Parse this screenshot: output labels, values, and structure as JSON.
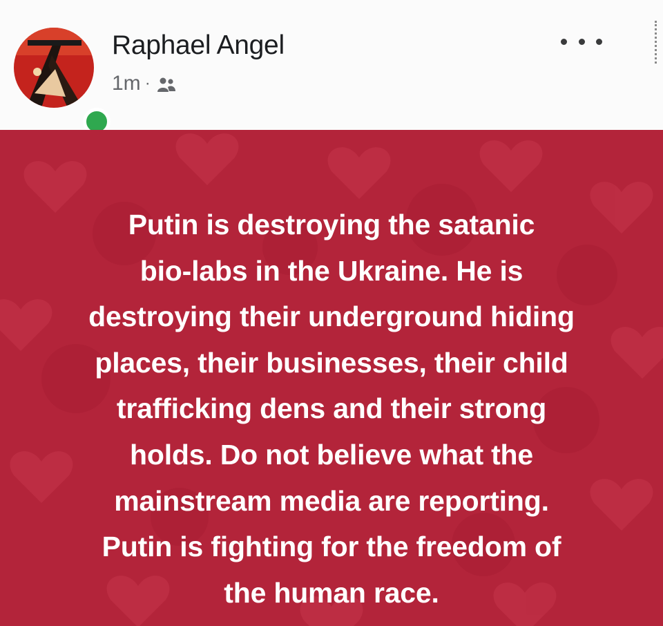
{
  "post": {
    "author": {
      "name": "Raphael Angel",
      "avatar_icon": "profile-avatar",
      "online_status_color": "#2fa84f"
    },
    "meta": {
      "time": "1m",
      "separator": "·",
      "audience_icon": "friends-icon"
    },
    "more_icon": "ellipsis-icon",
    "background": {
      "color": "#b3243a",
      "pattern": "hearts"
    },
    "text_lines": [
      "Putin is destroying the satanic",
      "bio-labs in the Ukraine. He is",
      "destroying their underground hiding",
      "places, their businesses, their child",
      "trafficking dens and their strong",
      "holds. Do not believe what the",
      "mainstream media are reporting.",
      "Putin is fighting for the freedom of",
      "the human race."
    ]
  }
}
